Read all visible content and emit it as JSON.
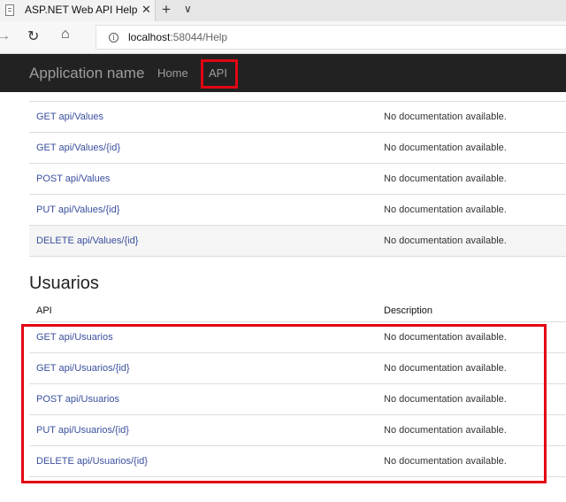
{
  "browser": {
    "tab_title": "ASP.NET Web API Help",
    "tab_close": "✕",
    "new_tab": "+",
    "tab_menu": "∨",
    "url_host": "localhost",
    "url_rest": ":58044/Help"
  },
  "navbar": {
    "brand": "Application name",
    "home": "Home",
    "api": "API"
  },
  "values_section": {
    "rows": [
      {
        "api": "GET api/Values",
        "description": "No documentation available."
      },
      {
        "api": "GET api/Values/{id}",
        "description": "No documentation available."
      },
      {
        "api": "POST api/Values",
        "description": "No documentation available."
      },
      {
        "api": "PUT api/Values/{id}",
        "description": "No documentation available."
      },
      {
        "api": "DELETE api/Values/{id}",
        "description": "No documentation available."
      }
    ]
  },
  "usuarios_section": {
    "title": "Usuarios",
    "col_api": "API",
    "col_description": "Description",
    "rows": [
      {
        "api": "GET api/Usuarios",
        "description": "No documentation available."
      },
      {
        "api": "GET api/Usuarios/{id}",
        "description": "No documentation available."
      },
      {
        "api": "POST api/Usuarios",
        "description": "No documentation available."
      },
      {
        "api": "PUT api/Usuarios/{id}",
        "description": "No documentation available."
      },
      {
        "api": "DELETE api/Usuarios/{id}",
        "description": "No documentation available."
      }
    ]
  },
  "colors": {
    "navbar_bg": "#222222",
    "link": "#3a4f9e",
    "highlight": "#e30613"
  },
  "icons": [
    "page-icon",
    "close-icon",
    "plus-icon",
    "chevron-down-icon",
    "forward-icon",
    "refresh-icon",
    "home-icon",
    "info-icon"
  ]
}
